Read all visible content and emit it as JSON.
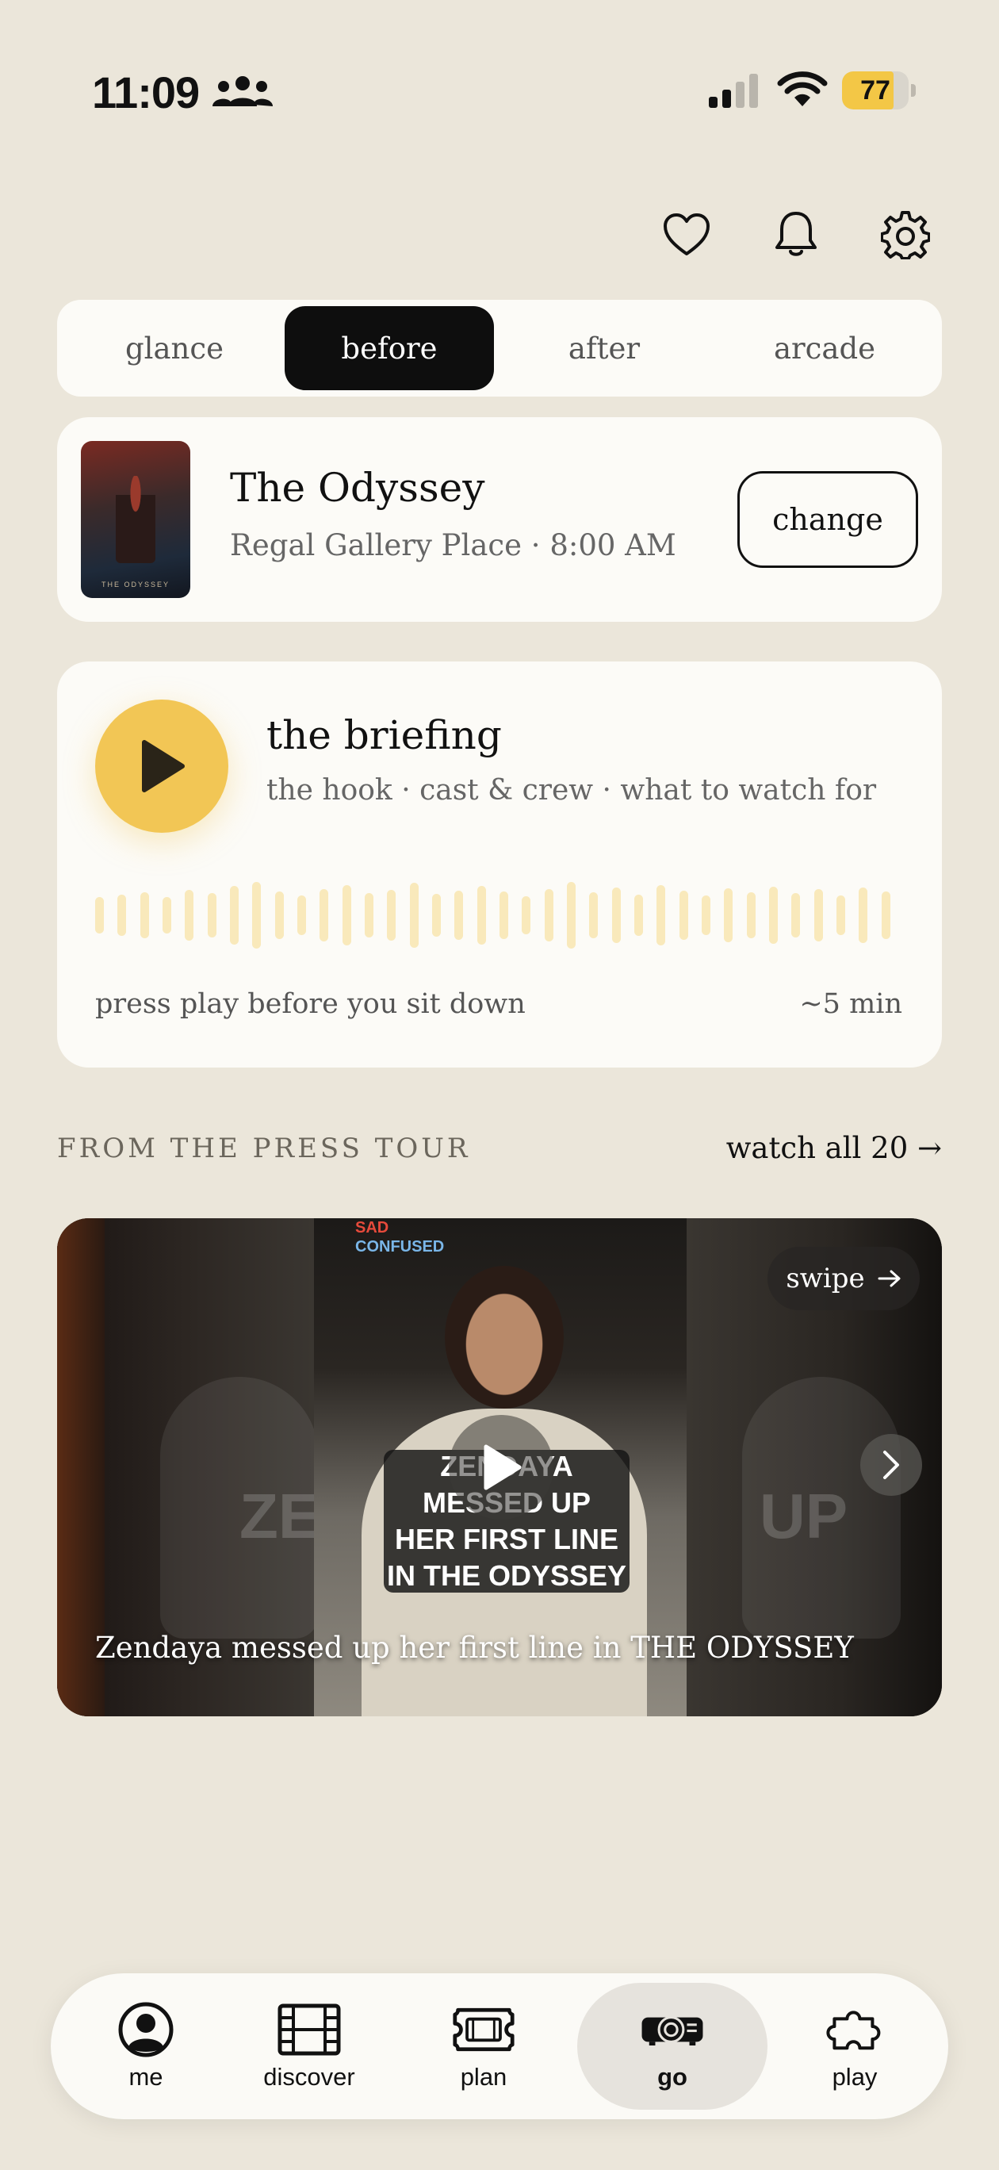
{
  "status_bar": {
    "time": "11:09",
    "battery": "77",
    "battery_level": 0.77,
    "icons": [
      "people-icon",
      "cellular-signal-icon",
      "wifi-icon",
      "battery-icon"
    ]
  },
  "header": {
    "icons": [
      "heart-icon",
      "bell-icon",
      "gear-icon"
    ]
  },
  "tabs": [
    {
      "label": "glance",
      "active": false
    },
    {
      "label": "before",
      "active": true
    },
    {
      "label": "after",
      "active": false
    },
    {
      "label": "arcade",
      "active": false
    }
  ],
  "movie": {
    "title": "The Odyssey",
    "subtitle": "Regal Gallery Place · 8:00 AM",
    "poster_text": "THE ODYSSEY",
    "change_label": "change"
  },
  "briefing": {
    "title": "the briefing",
    "subtitle": "the hook · cast & crew · what to watch for",
    "hint": "press play before you sit down",
    "duration": "~5 min"
  },
  "press_tour": {
    "section_label": "FROM THE PRESS TOUR",
    "watch_all_label": "watch all 20 →",
    "video": {
      "caption": "Zendaya messed up her first line in THE ODYSSEY",
      "overlay_lines": [
        "ZENDAYA MESSED UP",
        "HER FIRST LINE",
        "IN THE ODYSSEY"
      ],
      "tag_top": "SAD",
      "tag_bottom": "CONFUSED",
      "ghost_left_text": "ZE",
      "ghost_right_text": "UP",
      "swipe_label": "swipe"
    }
  },
  "colors": {
    "background": "#ebe6da",
    "card": "#fcfbf7",
    "accent": "#f2c655",
    "active_tab": "#0e0e0e"
  },
  "bottom_nav": [
    {
      "label": "me",
      "icon": "person-circle-icon",
      "active": false
    },
    {
      "label": "discover",
      "icon": "film-strip-icon",
      "active": false
    },
    {
      "label": "plan",
      "icon": "ticket-icon",
      "active": false
    },
    {
      "label": "go",
      "icon": "projector-icon",
      "active": true
    },
    {
      "label": "play",
      "icon": "puzzle-icon",
      "active": false
    }
  ]
}
